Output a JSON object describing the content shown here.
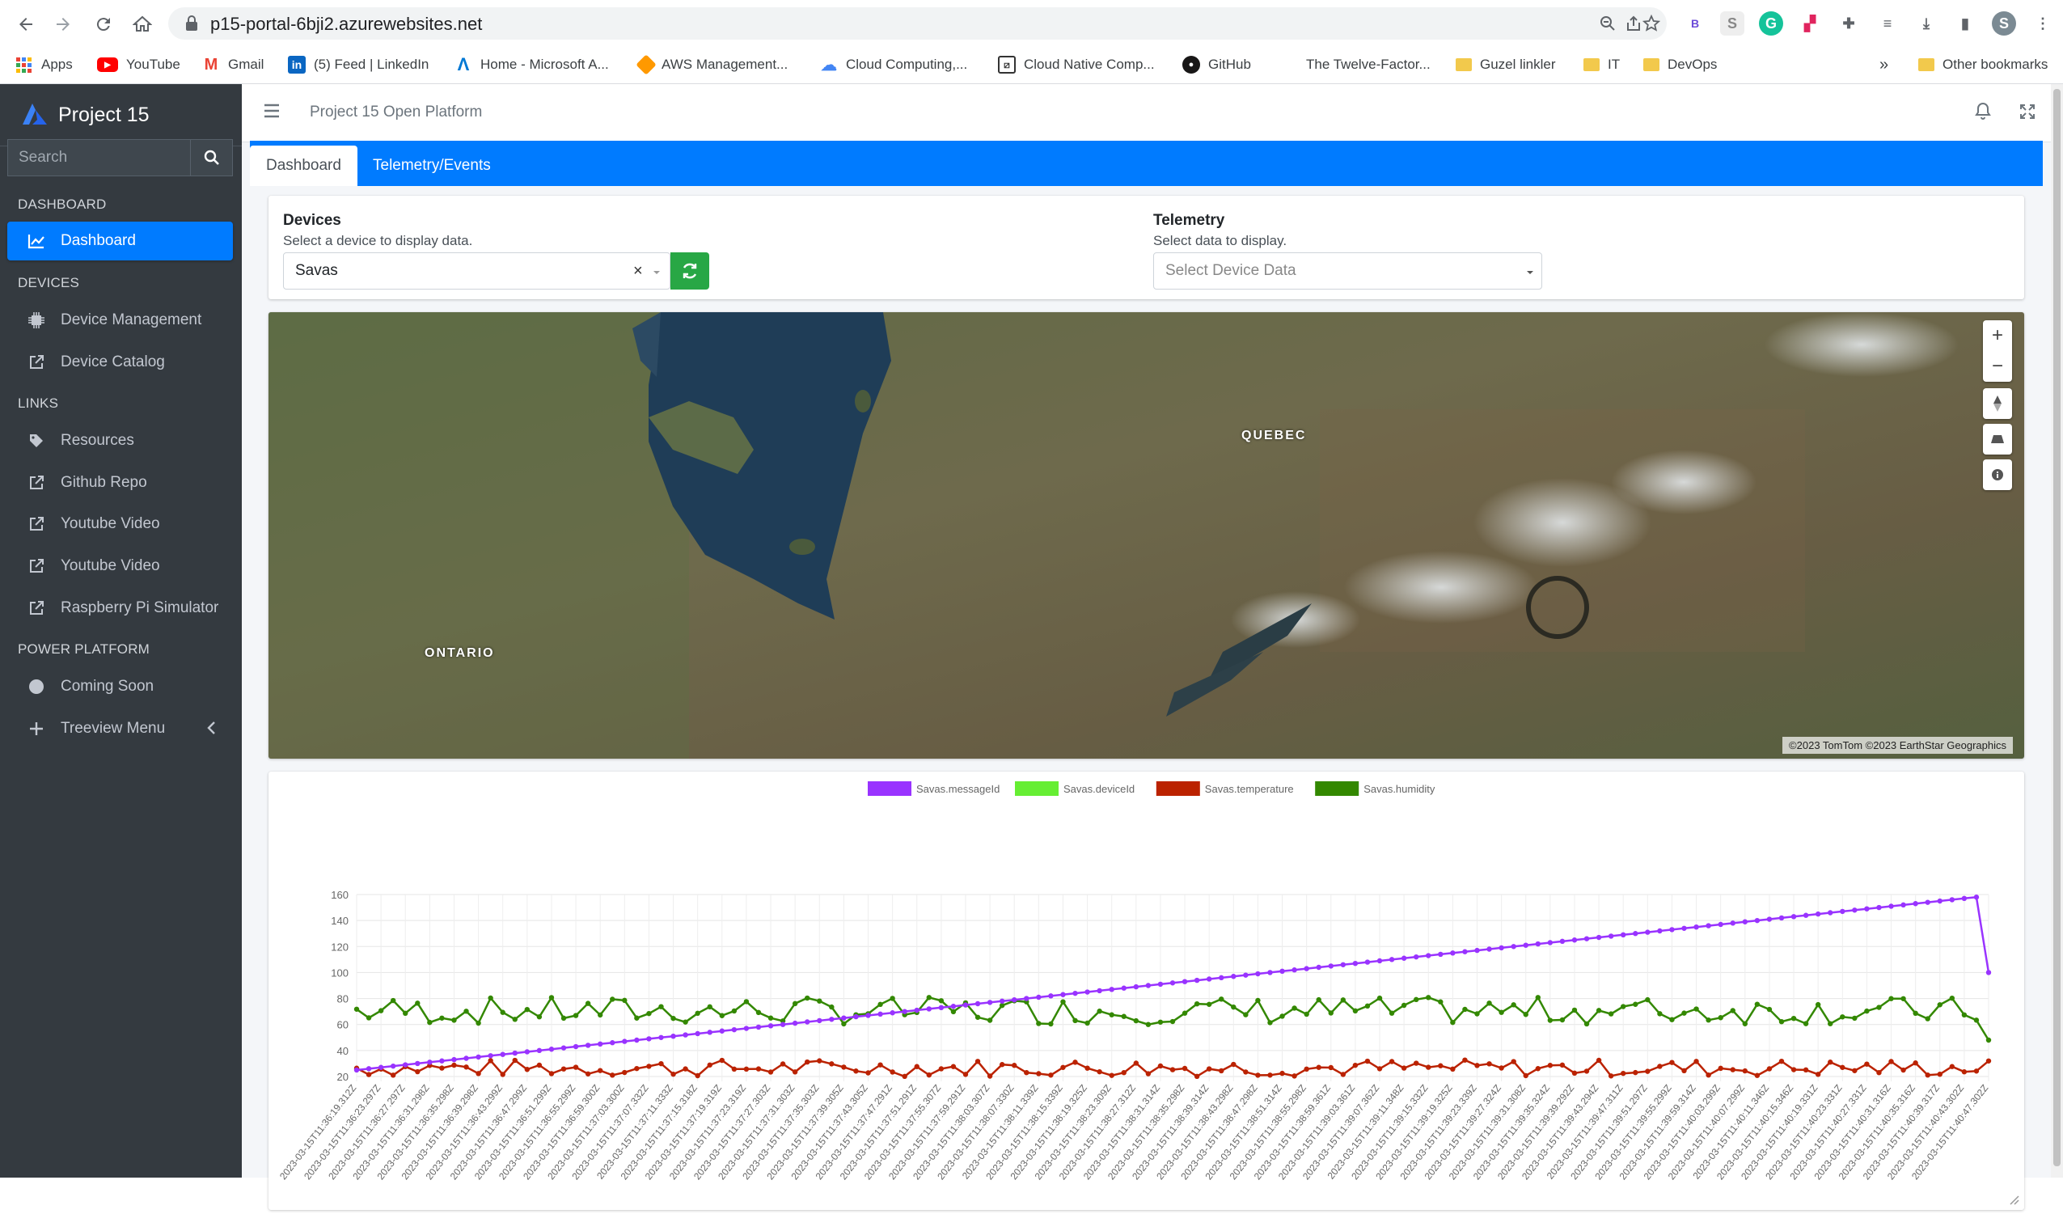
{
  "browser": {
    "url": "p15-portal-6bji2.azurewebsites.net",
    "bookmarks": [
      {
        "label": "Apps",
        "icon": "apps-grid-icon",
        "color": "#4285f4"
      },
      {
        "label": "YouTube",
        "icon": "youtube-icon",
        "color": "#ff0000"
      },
      {
        "label": "Gmail",
        "icon": "gmail-icon",
        "color": "#ea4335"
      },
      {
        "label": "(5) Feed | LinkedIn",
        "icon": "linkedin-icon",
        "color": "#0a66c2"
      },
      {
        "label": "Home - Microsoft A...",
        "icon": "azure-icon",
        "color": "#0078d4"
      },
      {
        "label": "AWS Management...",
        "icon": "aws-icon",
        "color": "#ff9900"
      },
      {
        "label": "Cloud Computing,...",
        "icon": "gcp-icon",
        "color": "#4285f4"
      },
      {
        "label": "Cloud Native Comp...",
        "icon": "cncf-icon",
        "color": "#333333"
      },
      {
        "label": "GitHub",
        "icon": "github-icon",
        "color": "#181717"
      },
      {
        "label": "The Twelve-Factor...",
        "icon": "",
        "color": ""
      },
      {
        "label": "Guzel linkler",
        "icon": "folder-icon",
        "color": "#f2c94c"
      },
      {
        "label": "IT",
        "icon": "folder-icon",
        "color": "#f2c94c"
      },
      {
        "label": "DevOps",
        "icon": "folder-icon",
        "color": "#f2c94c"
      }
    ],
    "more_bookmarks": "»",
    "other_bookmarks": "Other bookmarks",
    "profile_initial": "S"
  },
  "sidebar": {
    "brand": "Project 15",
    "search_placeholder": "Search",
    "sections": {
      "dashboard": "DASHBOARD",
      "devices": "DEVICES",
      "links": "LINKS",
      "power": "POWER PLATFORM"
    },
    "items": {
      "dashboard": "Dashboard",
      "device_management": "Device Management",
      "device_catalog": "Device Catalog",
      "resources": "Resources",
      "github_repo": "Github Repo",
      "youtube_1": "Youtube Video",
      "youtube_2": "Youtube Video",
      "raspberry": "Raspberry Pi Simulator",
      "coming_soon": "Coming Soon",
      "treeview": "Treeview Menu"
    }
  },
  "topnav": {
    "title": "Project 15 Open Platform"
  },
  "tabs": {
    "dashboard": "Dashboard",
    "telemetry": "Telemetry/Events"
  },
  "devices": {
    "label": "Devices",
    "sub": "Select a device to display data.",
    "selected": "Savas",
    "clear": "×"
  },
  "telemetry": {
    "label": "Telemetry",
    "sub": "Select data to display.",
    "placeholder": "Select Device Data"
  },
  "map": {
    "labels": {
      "quebec": "QUEBEC",
      "ontario": "ONTARIO"
    },
    "attribution": "©2023 TomTom ©2023 EarthStar Geographics"
  },
  "colors": {
    "accent": "#007bff",
    "sidebar": "#343a40",
    "refresh": "#28a745",
    "messageId": "#9933ff",
    "deviceId": "#66ee33",
    "temperature": "#bb2200",
    "humidity": "#338800"
  },
  "chart_data": {
    "type": "line",
    "title": "",
    "ylim": [
      20,
      160
    ],
    "yticks": [
      20,
      40,
      60,
      80,
      100,
      120,
      140,
      160
    ],
    "grid": true,
    "legend_position": "top-center",
    "x_first": "2023-03-15T11:36:19.312Z",
    "x_last": "2023-03-15T11:40:47.302Z",
    "x_tick_labels": [
      "2023-03-15T11:36:19.312Z",
      "2023-03-15T11:36:23.297Z",
      "2023-03-15T11:36:27.297Z",
      "2023-03-15T11:36:31.298Z",
      "2023-03-15T11:36:35.298Z",
      "2023-03-15T11:36:39.298Z",
      "2023-03-15T11:36:43.299Z",
      "2023-03-15T11:36:47.299Z",
      "2023-03-15T11:36:51.299Z",
      "2023-03-15T11:36:55.299Z",
      "2023-03-15T11:36:59.300Z",
      "2023-03-15T11:37:03.300Z",
      "2023-03-15T11:37:07.332Z",
      "2023-03-15T11:37:11.333Z",
      "2023-03-15T11:37:15.318Z",
      "2023-03-15T11:37:19.319Z",
      "2023-03-15T11:37:23.319Z",
      "2023-03-15T11:37:27.303Z",
      "2023-03-15T11:37:31.303Z",
      "2023-03-15T11:37:35.303Z",
      "2023-03-15T11:37:39.305Z",
      "2023-03-15T11:37:43.305Z",
      "2023-03-15T11:37:47.291Z",
      "2023-03-15T11:37:51.291Z",
      "2023-03-15T11:37:55.307Z",
      "2023-03-15T11:37:59.291Z",
      "2023-03-15T11:38:03.307Z",
      "2023-03-15T11:38:07.330Z",
      "2023-03-15T11:38:11.339Z",
      "2023-03-15T11:38:15.339Z",
      "2023-03-15T11:38:19.325Z",
      "2023-03-15T11:38:23.309Z",
      "2023-03-15T11:38:27.312Z",
      "2023-03-15T11:38:31.314Z",
      "2023-03-15T11:38:35.298Z",
      "2023-03-15T11:38:39.314Z",
      "2023-03-15T11:38:43.298Z",
      "2023-03-15T11:38:47.298Z",
      "2023-03-15T11:38:51.314Z",
      "2023-03-15T11:38:55.298Z",
      "2023-03-15T11:38:59.361Z",
      "2023-03-15T11:39:03.361Z",
      "2023-03-15T11:39:07.362Z",
      "2023-03-15T11:39:11.348Z",
      "2023-03-15T11:39:15.332Z",
      "2023-03-15T11:39:19.325Z",
      "2023-03-15T11:39:23.339Z",
      "2023-03-15T11:39:27.324Z",
      "2023-03-15T11:39:31.308Z",
      "2023-03-15T11:39:35.324Z",
      "2023-03-15T11:39:39.292Z",
      "2023-03-15T11:39:43.294Z",
      "2023-03-15T11:39:47.311Z",
      "2023-03-15T11:39:51.297Z",
      "2023-03-15T11:39:55.299Z",
      "2023-03-15T11:39:59.314Z",
      "2023-03-15T11:40:03.299Z",
      "2023-03-15T11:40:07.299Z",
      "2023-03-15T11:40:11.346Z",
      "2023-03-15T11:40:15.346Z",
      "2023-03-15T11:40:19.331Z",
      "2023-03-15T11:40:23.331Z",
      "2023-03-15T11:40:27.331Z",
      "2023-03-15T11:40:31.316Z",
      "2023-03-15T11:40:35.316Z",
      "2023-03-15T11:40:39.317Z",
      "2023-03-15T11:40:43.302Z",
      "2023-03-15T11:40:47.302Z"
    ],
    "n_points": 135,
    "series": [
      {
        "name": "Savas.messageId",
        "color": "#9933ff",
        "trend": "linear",
        "start": 25,
        "end": 158,
        "last_value": 100
      },
      {
        "name": "Savas.deviceId",
        "color": "#66ee33",
        "values": []
      },
      {
        "name": "Savas.temperature",
        "color": "#bb2200",
        "range": [
          20,
          33
        ]
      },
      {
        "name": "Savas.humidity",
        "color": "#338800",
        "range": [
          48,
          81
        ]
      }
    ]
  }
}
